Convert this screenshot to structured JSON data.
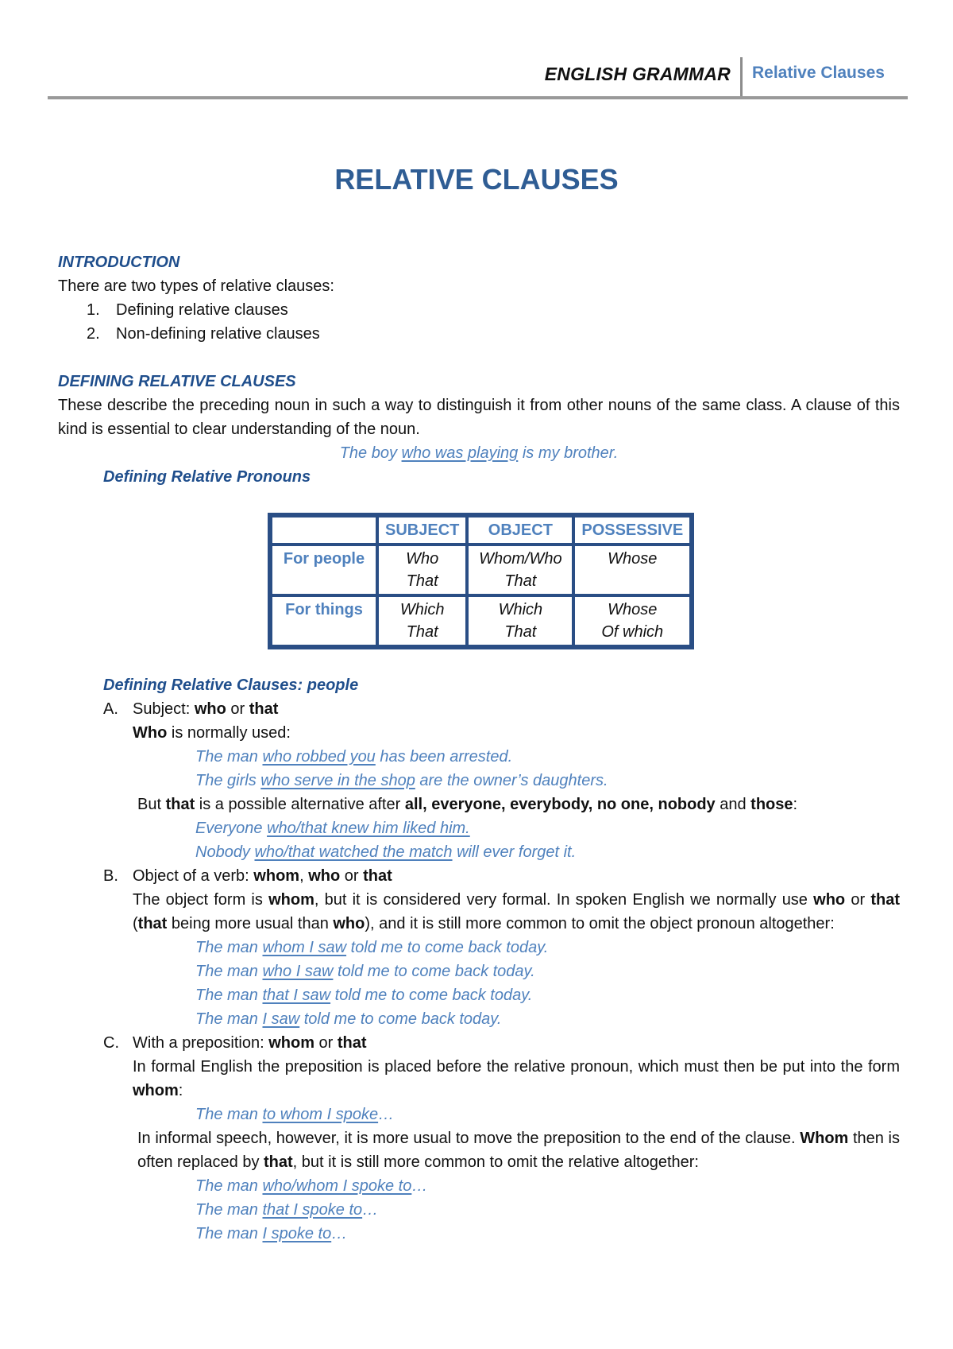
{
  "header": {
    "left_title": "ENGLISH GRAMMAR",
    "right_title": "Relative Clauses"
  },
  "title": "RELATIVE CLAUSES",
  "introduction": {
    "heading": "INTRODUCTION",
    "text": "There are two types of relative clauses:",
    "items": [
      {
        "num": "1.",
        "text": "Defining relative clauses"
      },
      {
        "num": "2.",
        "text": "Non-defining relative clauses"
      }
    ]
  },
  "defining": {
    "heading": "DEFINING RELATIVE CLAUSES",
    "text": "These describe the preceding noun in such a way to distinguish it from other nouns of the same class. A clause of this kind is essential to clear understanding of the noun.",
    "example": {
      "pre": "The boy ",
      "u": "who was playing",
      "post": " is my brother."
    },
    "pronouns_heading": "Defining Relative Pronouns",
    "table": {
      "headers": [
        "",
        "SUBJECT",
        "OBJECT",
        "POSSESSIVE"
      ],
      "rows": [
        {
          "label": "For people",
          "cells": [
            [
              "Who",
              "That"
            ],
            [
              "Whom/Who",
              "That"
            ],
            [
              "Whose"
            ]
          ]
        },
        {
          "label": "For things",
          "cells": [
            [
              "Which",
              "That"
            ],
            [
              "Which",
              "That"
            ],
            [
              "Whose",
              "Of which"
            ]
          ]
        }
      ]
    }
  },
  "people": {
    "heading": "Defining Relative Clauses: people",
    "A": {
      "letter": "A.",
      "title_pre": "Subject: ",
      "title_b1": "who",
      "title_mid": " or ",
      "title_b2": "that",
      "line_b": "Who",
      "line_rest": " is normally used:",
      "examples": [
        {
          "pre": "The man ",
          "u": "who robbed you",
          "post": " has been arrested."
        },
        {
          "pre": "The girls ",
          "u": "who serve in the shop",
          "post": " are the owner’s daughters."
        }
      ],
      "but_pre": "But ",
      "but_b1": "that",
      "but_mid": " is a possible alternative after ",
      "but_b2": "all, everyone, everybody, no one, nobody",
      "but_and": " and ",
      "but_b3": "those",
      "but_end": ":",
      "examples2": [
        {
          "pre": "Everyone ",
          "u": "who/that knew him liked him.",
          "post": ""
        },
        {
          "pre": "Nobody ",
          "u": "who/that watched the match",
          "post": " will ever forget it."
        }
      ]
    },
    "B": {
      "letter": "B.",
      "title_pre": "Object of a verb: ",
      "title_b1": "whom",
      "title_sep1": ", ",
      "title_b2": "who",
      "title_mid": " or ",
      "title_b3": "that",
      "p1": "The object form is ",
      "p1b": "whom",
      "p2": ", but it is considered very formal. In spoken English we normally use ",
      "p2b": "who",
      "p3": " or ",
      "p3b": "that",
      "p4": " (",
      "p4b": "that",
      "p5": " being more usual than ",
      "p5b": "who",
      "p6": "), and it is still more common to omit the object pronoun altogether:",
      "examples": [
        {
          "pre": "The man ",
          "u": "whom I saw",
          "post": " told me to come back today."
        },
        {
          "pre": "The man ",
          "u": "who I saw",
          "post": " told me to come back today."
        },
        {
          "pre": "The man ",
          "u": "that I saw",
          "post": " told me to come back today."
        },
        {
          "pre": "The man ",
          "u": "I saw",
          "post": " told me to come back today."
        }
      ]
    },
    "C": {
      "letter": "C.",
      "title_pre": "With a preposition: ",
      "title_b1": "whom",
      "title_mid": " or ",
      "title_b2": "that",
      "p1": "In formal English the preposition is placed before the relative pronoun, which must then be put into the form ",
      "p1b": "whom",
      "p1end": ":",
      "example1": {
        "pre": "The man ",
        "u": "to whom I spoke",
        "post": "…"
      },
      "p2": "In informal speech, however, it is more usual to move the preposition to the end of the clause.",
      "p3b": "Whom",
      "p3": " then is often replaced by ",
      "p3b2": "that",
      "p3end": ", but it is still more common to omit the relative altogether:",
      "examples": [
        {
          "pre": "The man ",
          "u": "who/whom I spoke to",
          "post": "…"
        },
        {
          "pre": "The man ",
          "u": "that I spoke to",
          "post": "…"
        },
        {
          "pre": "The man ",
          "u": "I spoke to",
          "post": "…"
        }
      ]
    }
  }
}
